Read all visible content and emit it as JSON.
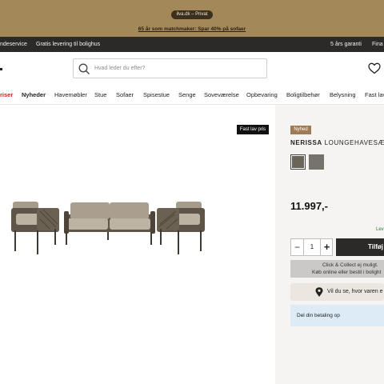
{
  "promo": {
    "pill": "ilva.dk – Privat",
    "link": "65 år som matchmaker: Spar 40% på sofaer"
  },
  "servicebar": {
    "left_1": "ndeservice",
    "left_2": "Gratis levering til bolighus",
    "right_1": "5 års garanti",
    "right_2": "Fina"
  },
  "search": {
    "placeholder": "Hvad leder du efter?",
    "icon": "search-icon"
  },
  "header": {
    "wishlist_icon": "heart-icon"
  },
  "nav": {
    "items": [
      "riser",
      "Nyheder",
      "Havemøbler",
      "Stue",
      "Sofaer",
      "Spisestue",
      "Senge",
      "Soveværelse",
      "Opbevaring",
      "Boligtilbehør",
      "Belysning",
      "Fast lav"
    ]
  },
  "product": {
    "badge_price": "Fast lav pris",
    "badge_new": "Nyhed",
    "name_bold": "NERISSA",
    "name_rest": "LOUNGEHAVESÆT",
    "swatches": [
      "#6b6459",
      "#76736c"
    ],
    "price": "11.997,-",
    "delivery": "Lev",
    "quantity": "1",
    "qty_minus": "−",
    "qty_plus": "+",
    "add_to_cart": "Tilføj",
    "click_collect_1": "Click & Collect ej muligt.",
    "click_collect_2": "Køb online eller bestil i bolight",
    "store_text": "Vil du se, hvor varen e",
    "payment": "Del din betaling op"
  },
  "colors": {
    "promo_bg": "#a3885a",
    "servicebar_bg": "#2b2a28",
    "sale_red": "#d0231b",
    "new_badge": "#a07a55"
  }
}
